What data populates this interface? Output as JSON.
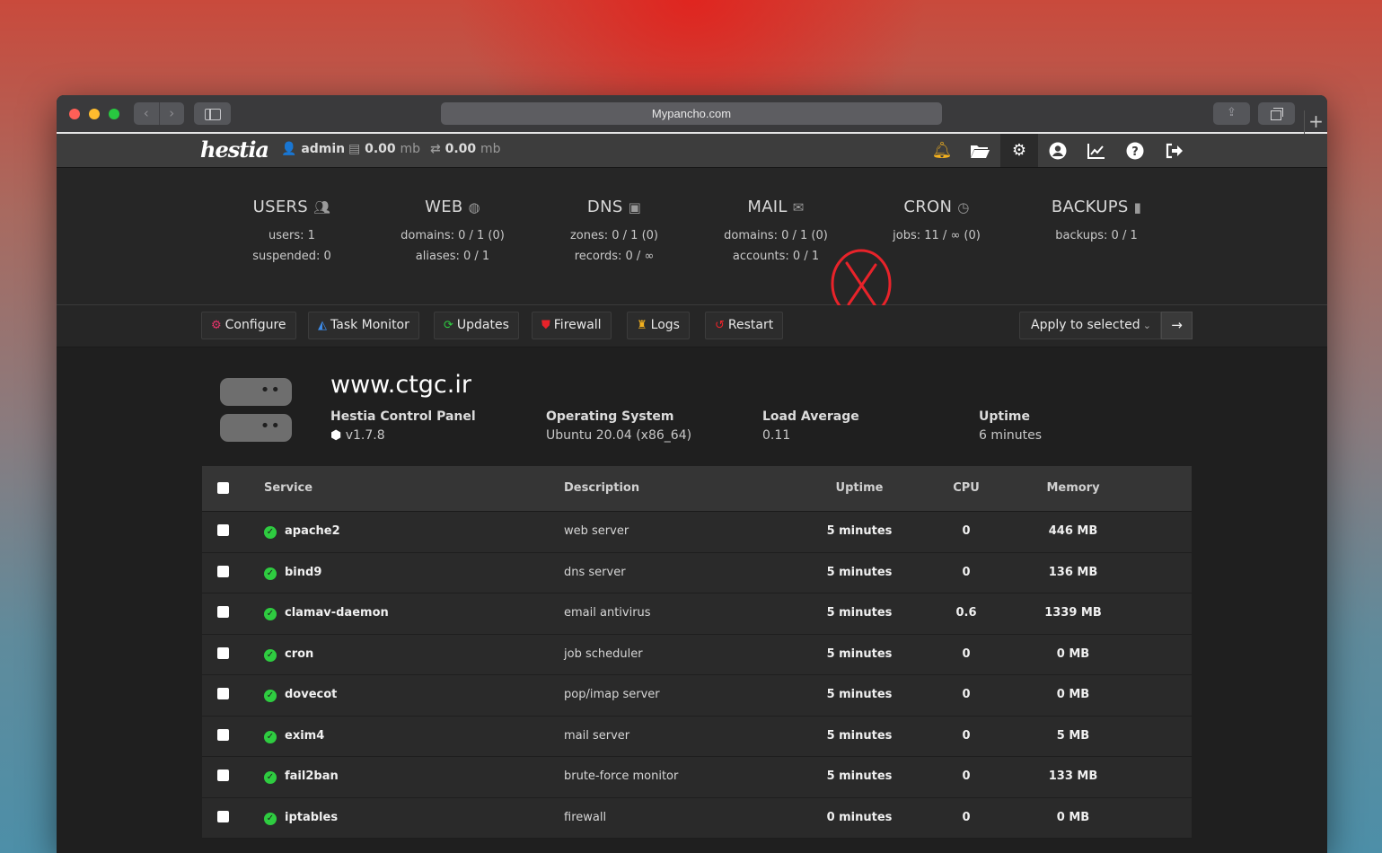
{
  "browser": {
    "url": "Mypancho.com"
  },
  "header": {
    "logo": "hestia",
    "user": "admin",
    "disk_value": "0.00",
    "disk_unit": "mb",
    "bandwidth_value": "0.00",
    "bandwidth_unit": "mb",
    "icons": [
      "bell-icon",
      "folder-icon",
      "gear-icon",
      "user-circle-icon",
      "chart-icon",
      "help-icon",
      "logout-icon"
    ]
  },
  "stats": [
    {
      "title": "USERS",
      "icon": "users-icon",
      "line1": "users: 1",
      "line2": "suspended: 0"
    },
    {
      "title": "WEB",
      "icon": "globe-icon",
      "line1": "domains: 0 / 1 (0)",
      "line2": "aliases: 0 / 1"
    },
    {
      "title": "DNS",
      "icon": "address-book-icon",
      "line1": "zones: 0 / 1 (0)",
      "line2": "records: 0 / ∞"
    },
    {
      "title": "MAIL",
      "icon": "mail-icon",
      "line1": "domains: 0 / 1 (0)",
      "line2": "accounts: 0 / 1"
    },
    {
      "title": "CRON",
      "icon": "clock-icon",
      "line1": "jobs: 11 / ∞ (0)",
      "line2": ""
    },
    {
      "title": "BACKUPS",
      "icon": "file-icon",
      "line1": "backups: 0 / 1",
      "line2": ""
    }
  ],
  "toolbar": {
    "configure": "Configure",
    "task_monitor": "Task Monitor",
    "updates": "Updates",
    "firewall": "Firewall",
    "logs": "Logs",
    "restart": "Restart",
    "apply_selected": "Apply to selected"
  },
  "server": {
    "hostname": "www.ctgc.ir",
    "panel_label": "Hestia Control Panel",
    "panel_version": "v1.7.8",
    "os_label": "Operating System",
    "os_value": "Ubuntu 20.04 (x86_64)",
    "load_label": "Load Average",
    "load_value": "0.11",
    "uptime_label": "Uptime",
    "uptime_value": "6 minutes"
  },
  "table": {
    "headers": {
      "service": "Service",
      "description": "Description",
      "uptime": "Uptime",
      "cpu": "CPU",
      "memory": "Memory"
    },
    "rows": [
      {
        "service": "apache2",
        "description": "web server",
        "uptime": "5 minutes",
        "cpu": "0",
        "memory": "446 MB"
      },
      {
        "service": "bind9",
        "description": "dns server",
        "uptime": "5 minutes",
        "cpu": "0",
        "memory": "136 MB"
      },
      {
        "service": "clamav-daemon",
        "description": "email antivirus",
        "uptime": "5 minutes",
        "cpu": "0.6",
        "memory": "1339 MB"
      },
      {
        "service": "cron",
        "description": "job scheduler",
        "uptime": "5 minutes",
        "cpu": "0",
        "memory": "0 MB"
      },
      {
        "service": "dovecot",
        "description": "pop/imap server",
        "uptime": "5 minutes",
        "cpu": "0",
        "memory": "0 MB"
      },
      {
        "service": "exim4",
        "description": "mail server",
        "uptime": "5 minutes",
        "cpu": "0",
        "memory": "5 MB"
      },
      {
        "service": "fail2ban",
        "description": "brute-force monitor",
        "uptime": "5 minutes",
        "cpu": "0",
        "memory": "133 MB"
      },
      {
        "service": "iptables",
        "description": "firewall",
        "uptime": "0 minutes",
        "cpu": "0",
        "memory": "0 MB"
      }
    ]
  }
}
